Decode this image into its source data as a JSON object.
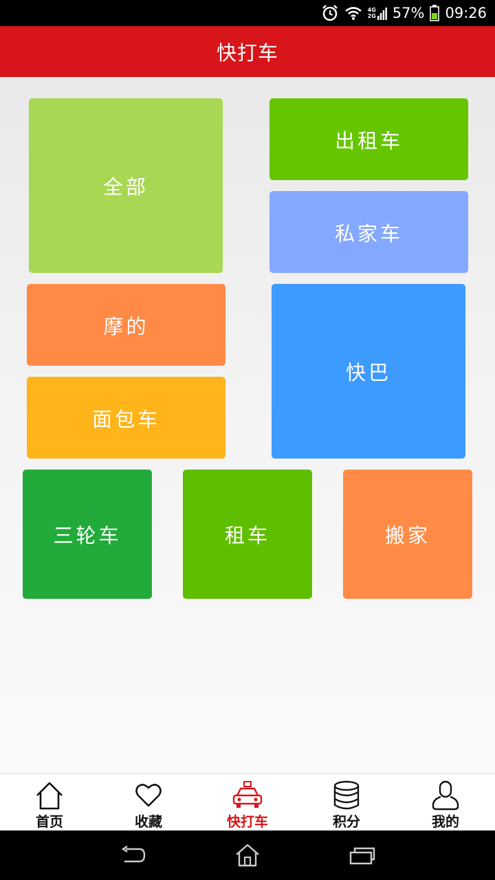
{
  "status_bar": {
    "network_top": "4G",
    "network_bottom": "2G",
    "battery_percent": "57%",
    "time": "09:26"
  },
  "header": {
    "title": "快打车"
  },
  "tiles": {
    "all": {
      "label": "全部",
      "color": "#a8d753"
    },
    "taxi": {
      "label": "出租车",
      "color": "#65c600"
    },
    "private_car": {
      "label": "私家车",
      "color": "#84a8fe"
    },
    "moto": {
      "label": "摩的",
      "color": "#ff8a46"
    },
    "minibus": {
      "label": "快巴",
      "color": "#3d9aff"
    },
    "van": {
      "label": "面包车",
      "color": "#ffb41a"
    },
    "tricycle": {
      "label": "三轮车",
      "color": "#22ab3a"
    },
    "rental": {
      "label": "租车",
      "color": "#5fbe00"
    },
    "moving": {
      "label": "搬家",
      "color": "#ff8b46"
    }
  },
  "bottom_nav": {
    "items": [
      {
        "label": "首页",
        "icon": "home-icon"
      },
      {
        "label": "收藏",
        "icon": "heart-icon"
      },
      {
        "label": "快打车",
        "icon": "taxi-icon",
        "active": true
      },
      {
        "label": "积分",
        "icon": "coins-icon"
      },
      {
        "label": "我的",
        "icon": "user-icon"
      }
    ],
    "active_color": "#d8151a"
  },
  "system_nav": {
    "buttons": [
      "back-icon",
      "home-icon",
      "recent-apps-icon"
    ]
  }
}
